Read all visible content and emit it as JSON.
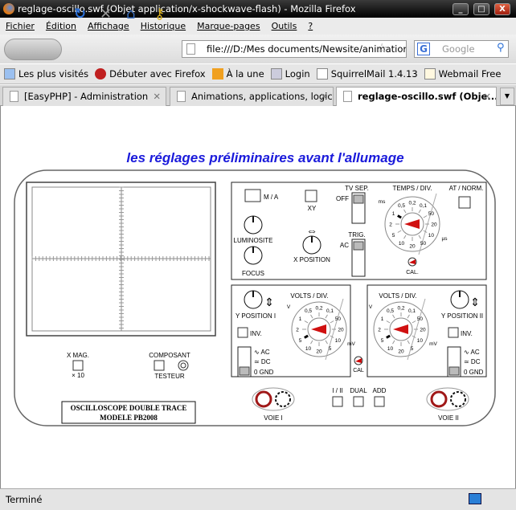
{
  "window": {
    "title": "reglage-oscillo.swf (Objet application/x-shockwave-flash) - Mozilla Firefox",
    "buttons": [
      "_",
      "□",
      "X"
    ]
  },
  "menu": [
    "Fichier",
    "Édition",
    "Affichage",
    "Historique",
    "Marque-pages",
    "Outils",
    "?"
  ],
  "nav": {
    "url": "file:///D:/Mes documents/Newsite/animation",
    "search_placeholder": "Google",
    "search_engine": "G"
  },
  "bookmarks": [
    "Les plus visités",
    "Débuter avec Firefox",
    "À la une",
    "Login",
    "SquirrelMail 1.4.13",
    "Webmail Free"
  ],
  "tabs": [
    {
      "label": "[EasyPHP] - Administration",
      "active": false
    },
    {
      "label": "Animations, applications, logic...",
      "active": false
    },
    {
      "label": "reglage-oscillo.swf (Obje...",
      "active": true
    }
  ],
  "status": "Terminé",
  "scope": {
    "heading": "les réglages préliminaires avant l'allumage",
    "accent": "#1a1adb",
    "labels": {
      "ma": "M / A",
      "xy": "XY",
      "tvsep": "TV SEP.",
      "off": "OFF",
      "trig": "TRIG.",
      "ac_trig": "AC",
      "temps": "TEMPS / DIV.",
      "atnorm": "AT / NORM.",
      "lum": "LUMINOSITE",
      "focus": "FOCUS",
      "xpos": "X POSITION",
      "cal": "CAL.",
      "volts": "VOLTS / DIV.",
      "ypos1": "Y POSITION I",
      "ypos2": "Y POSITION II",
      "inv": "INV.",
      "ac": "AC",
      "dc": "DC",
      "gnd": "0  GND",
      "cal2": "CAL",
      "xmag": "X MAG.",
      "x10": "× 10",
      "composant": "COMPOSANT",
      "testeur": "TESTEUR",
      "i_ii": "I / II",
      "dual": "DUAL",
      "add": "ADD",
      "voie1": "VOIE I",
      "voie2": "VOIE II",
      "model1": "OSCILLOSCOPE DOUBLE TRACE",
      "model2": "MODELE PB2008"
    },
    "timebase": {
      "unit_left": "ms",
      "unit_right": "µs",
      "ticks": [
        "1",
        "0,5",
        "0,2",
        "0,1",
        "50",
        "20",
        "10",
        "50",
        "20",
        "10",
        "5",
        "2"
      ]
    },
    "volts_dial": {
      "unit_left": "V",
      "unit_right": "mV",
      "ticks": [
        "1",
        "0,5",
        "0,2",
        "0,1",
        "50",
        "20",
        "10",
        "5",
        "20",
        "10",
        "5",
        "2"
      ]
    }
  }
}
